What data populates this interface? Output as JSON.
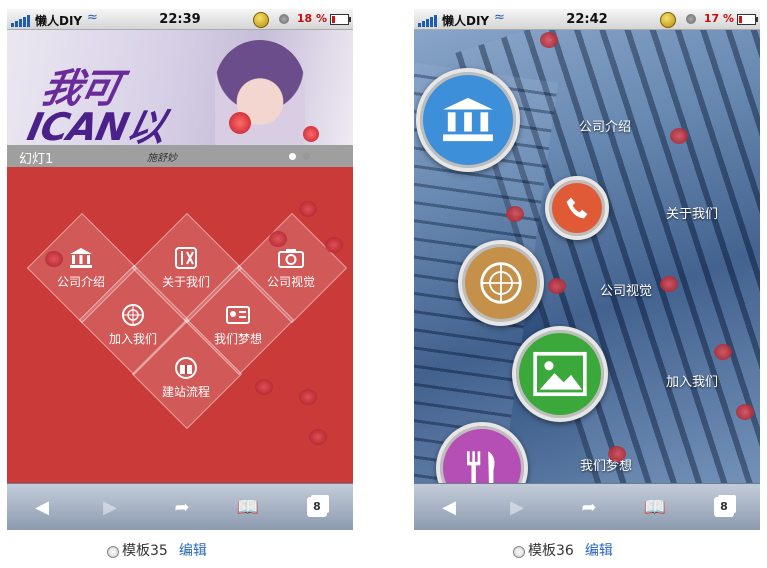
{
  "status_bar": {
    "carrier": "懒人DIY",
    "phone35_time": "22:39",
    "phone35_battery": "18 %",
    "phone36_time": "22:42",
    "phone36_battery": "17 %"
  },
  "template35": {
    "banner_logo_line1": "我可",
    "banner_logo_line2": "ICAN以",
    "banner_signature": "施舒妙",
    "slide_caption": "幻灯1",
    "tiles": [
      {
        "label": "公司介绍",
        "icon": "building-icon"
      },
      {
        "label": "关于我们",
        "icon": "scissors-ruler-icon"
      },
      {
        "label": "公司视觉",
        "icon": "camera-icon"
      },
      {
        "label": "加入我们",
        "icon": "radar-icon"
      },
      {
        "label": "我们梦想",
        "icon": "id-card-icon"
      },
      {
        "label": "建站流程",
        "icon": "gift-icon"
      }
    ]
  },
  "template36": {
    "items": [
      {
        "label": "公司介绍",
        "icon": "building-icon",
        "color": "#3c8fd8"
      },
      {
        "label": "关于我们",
        "icon": "phone-icon",
        "color": "#e05a36"
      },
      {
        "label": "公司视觉",
        "icon": "radar-icon",
        "color": "#c4904a"
      },
      {
        "label": "加入我们",
        "icon": "picture-icon",
        "color": "#3aa83a"
      },
      {
        "label": "我们梦想",
        "icon": "utensils-icon",
        "color": "#b64fb5"
      }
    ]
  },
  "toolbar": {
    "tab_count": "8"
  },
  "captions": [
    {
      "name": "模板35",
      "edit": "编辑"
    },
    {
      "name": "模板36",
      "edit": "编辑"
    }
  ]
}
